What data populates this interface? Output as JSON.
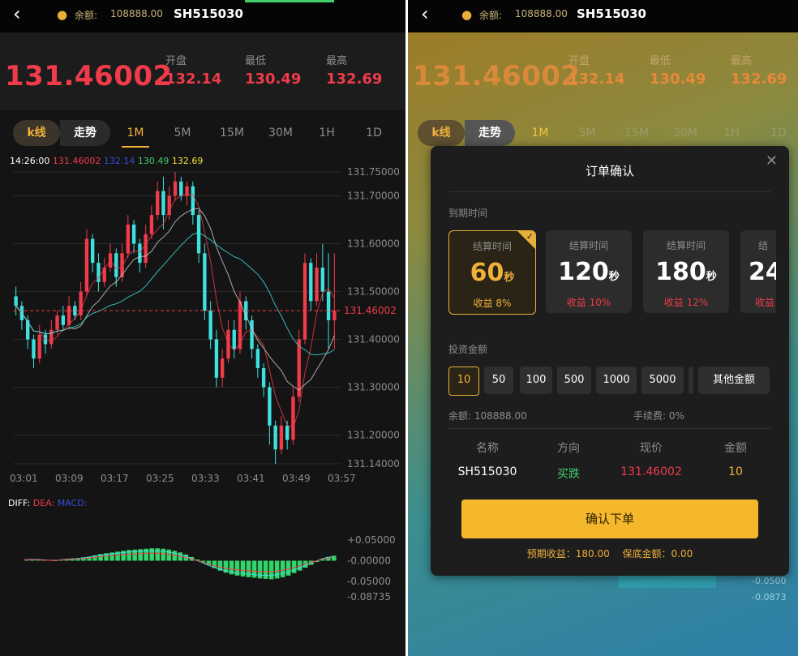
{
  "top": {
    "balance_label": "余额:",
    "balance_value": "108888.00",
    "symbol": "SH515030"
  },
  "quote": {
    "price": "131.46002",
    "open_label": "开盘",
    "open_value": "132.14",
    "low_label": "最低",
    "low_value": "130.49",
    "high_label": "最高",
    "high_value": "132.69"
  },
  "tabs": {
    "kline": "k线",
    "trend": "走势",
    "periods": [
      "1M",
      "5M",
      "15M",
      "30M",
      "1H",
      "1D"
    ]
  },
  "info": {
    "time": "14:26:00",
    "v1": "131.46002",
    "v2": "132.14",
    "v3": "130.49",
    "v4": "132.69"
  },
  "chart_data": [
    {
      "type": "candlestick",
      "x_ticks": [
        "03:01",
        "03:09",
        "03:17",
        "03:25",
        "03:33",
        "03:41",
        "03:49",
        "03:57"
      ],
      "y_ticks": [
        "131.75000",
        "131.70000",
        "131.60000",
        "131.50000",
        "131.40000",
        "131.30000",
        "131.20000",
        "131.14000"
      ],
      "ylim": [
        131.14,
        131.75
      ],
      "current_price_label": "131.46002",
      "current_price": 131.46002,
      "colors": {
        "up": "#ef3b4a",
        "down": "#3fe0e0"
      },
      "candles": [
        [
          131.49,
          131.47,
          131.51,
          131.45
        ],
        [
          131.47,
          131.44,
          131.48,
          131.42
        ],
        [
          131.44,
          131.4,
          131.45,
          131.38
        ],
        [
          131.4,
          131.36,
          131.41,
          131.34
        ],
        [
          131.36,
          131.41,
          131.43,
          131.35
        ],
        [
          131.41,
          131.39,
          131.42,
          131.37
        ],
        [
          131.39,
          131.42,
          131.44,
          131.38
        ],
        [
          131.42,
          131.45,
          131.46,
          131.41
        ],
        [
          131.45,
          131.43,
          131.47,
          131.42
        ],
        [
          131.43,
          131.47,
          131.49,
          131.42
        ],
        [
          131.47,
          131.45,
          131.48,
          131.44
        ],
        [
          131.45,
          131.5,
          131.52,
          131.44
        ],
        [
          131.5,
          131.61,
          131.63,
          131.49
        ],
        [
          131.61,
          131.56,
          131.62,
          131.54
        ],
        [
          131.56,
          131.52,
          131.58,
          131.5
        ],
        [
          131.52,
          131.55,
          131.57,
          131.51
        ],
        [
          131.55,
          131.58,
          131.6,
          131.54
        ],
        [
          131.58,
          131.53,
          131.59,
          131.51
        ],
        [
          131.53,
          131.58,
          131.6,
          131.52
        ],
        [
          131.58,
          131.64,
          131.66,
          131.57
        ],
        [
          131.64,
          131.6,
          131.65,
          131.58
        ],
        [
          131.6,
          131.56,
          131.61,
          131.54
        ],
        [
          131.56,
          131.62,
          131.64,
          131.55
        ],
        [
          131.62,
          131.66,
          131.68,
          131.61
        ],
        [
          131.66,
          131.71,
          131.73,
          131.65
        ],
        [
          131.71,
          131.66,
          131.74,
          131.63
        ],
        [
          131.66,
          131.7,
          131.72,
          131.65
        ],
        [
          131.7,
          131.73,
          131.75,
          131.69
        ],
        [
          131.73,
          131.7,
          131.74,
          131.69
        ],
        [
          131.7,
          131.72,
          131.73,
          131.68
        ],
        [
          131.72,
          131.66,
          131.73,
          131.64
        ],
        [
          131.66,
          131.58,
          131.67,
          131.56
        ],
        [
          131.58,
          131.46,
          131.6,
          131.44
        ],
        [
          131.46,
          131.4,
          131.48,
          131.38
        ],
        [
          131.4,
          131.32,
          131.42,
          131.3
        ],
        [
          131.32,
          131.36,
          131.38,
          131.3
        ],
        [
          131.36,
          131.42,
          131.44,
          131.35
        ],
        [
          131.42,
          131.38,
          131.44,
          131.36
        ],
        [
          131.38,
          131.48,
          131.5,
          131.37
        ],
        [
          131.48,
          131.44,
          131.49,
          131.42
        ],
        [
          131.44,
          131.38,
          131.45,
          131.36
        ],
        [
          131.38,
          131.34,
          131.39,
          131.32
        ],
        [
          131.34,
          131.3,
          131.35,
          131.28
        ],
        [
          131.3,
          131.22,
          131.31,
          131.18
        ],
        [
          131.22,
          131.17,
          131.23,
          131.14
        ],
        [
          131.17,
          131.22,
          131.24,
          131.16
        ],
        [
          131.22,
          131.19,
          131.23,
          131.17
        ],
        [
          131.19,
          131.28,
          131.3,
          131.18
        ],
        [
          131.28,
          131.4,
          131.42,
          131.27
        ],
        [
          131.4,
          131.56,
          131.58,
          131.39
        ],
        [
          131.56,
          131.48,
          131.57,
          131.46
        ],
        [
          131.48,
          131.55,
          131.58,
          131.47
        ],
        [
          131.55,
          131.5,
          131.6,
          131.48
        ],
        [
          131.5,
          131.44,
          131.58,
          131.38
        ],
        [
          131.44,
          131.46002,
          131.58,
          131.38
        ]
      ]
    },
    {
      "type": "bar",
      "title": "DIFF: DEA: MACD:",
      "y_ticks": [
        "+0.05000",
        "-0.00000",
        "-0.05000",
        "-0.08735"
      ],
      "ylim": [
        -0.08735,
        0.05
      ],
      "values": [
        0.003,
        0.004,
        0.004,
        0.003,
        0.002,
        0.001,
        0.002,
        0.004,
        0.005,
        0.006,
        0.008,
        0.01,
        0.013,
        0.016,
        0.018,
        0.02,
        0.022,
        0.024,
        0.026,
        0.027,
        0.028,
        0.029,
        0.03,
        0.03,
        0.029,
        0.027,
        0.024,
        0.02,
        0.015,
        0.009,
        0.003,
        -0.004,
        -0.011,
        -0.018,
        -0.024,
        -0.029,
        -0.033,
        -0.036,
        -0.038,
        -0.04,
        -0.041,
        -0.043,
        -0.044,
        -0.045,
        -0.043,
        -0.04,
        -0.036,
        -0.03,
        -0.024,
        -0.017,
        -0.01,
        -0.003,
        0.004,
        0.009,
        0.012
      ]
    }
  ],
  "modal": {
    "title": "订单确认",
    "expiry_label": "到期时间",
    "options": [
      {
        "label": "结算时间",
        "num": "60",
        "unit": "秒",
        "profit": "收益 8%"
      },
      {
        "label": "结算时间",
        "num": "120",
        "unit": "秒",
        "profit": "收益 10%"
      },
      {
        "label": "结算时间",
        "num": "180",
        "unit": "秒",
        "profit": "收益 12%"
      },
      {
        "label": "结",
        "num": "24",
        "unit": "",
        "profit": "收益"
      }
    ],
    "invest_label": "投资金额",
    "amounts": [
      "10",
      "50",
      "100",
      "500",
      "1000",
      "5000"
    ],
    "other_amount": "其他金额",
    "balance": "余额: 108888.00",
    "fee": "手续费: 0%",
    "headers": [
      "名称",
      "方向",
      "现价",
      "金额"
    ],
    "row": [
      "SH515030",
      "买跌",
      "131.46002",
      "10"
    ],
    "confirm": "确认下单",
    "expected": "预期收益：180.00",
    "margin": "保底金额：0.00"
  },
  "colors": {
    "red": "#ef3b4a",
    "gold": "#f0b13b",
    "cyan": "#3fe0e0",
    "green": "#41d06a"
  }
}
